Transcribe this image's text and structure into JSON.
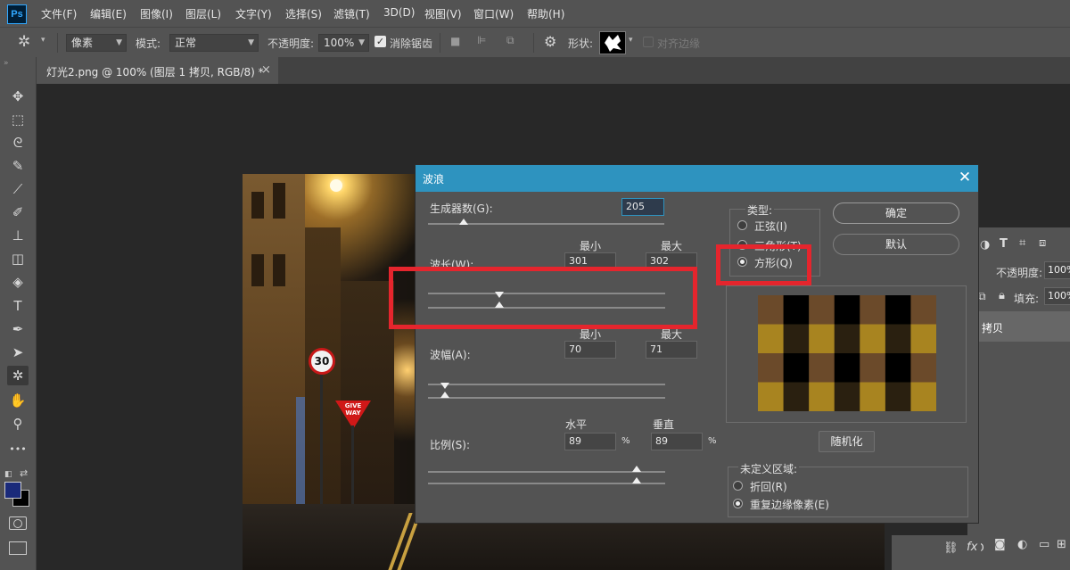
{
  "app": {
    "logo_text": "Ps",
    "accent": "#31a8ff"
  },
  "menu": [
    "文件(F)",
    "编辑(E)",
    "图像(I)",
    "图层(L)",
    "文字(Y)",
    "选择(S)",
    "滤镜(T)",
    "3D(D)",
    "视图(V)",
    "窗口(W)",
    "帮助(H)"
  ],
  "options": {
    "tool_icon": "puppet-warp-icon",
    "pixel_mode": "像素",
    "mode_label": "模式:",
    "mode_value": "正常",
    "opacity_label": "不透明度:",
    "opacity_value": "100%",
    "antialias_label": "消除锯齿",
    "antialias_checked": true,
    "shape_label": "形状:",
    "align_edges_label": "对齐边缘"
  },
  "document": {
    "tab_title": "灯光2.png @ 100% (图层 1 拷贝, RGB/8) *",
    "close": "×"
  },
  "toolbar": {
    "tools": [
      {
        "name": "move-tool-icon",
        "glyph": "✥"
      },
      {
        "name": "marquee-tool-icon",
        "glyph": "⬚"
      },
      {
        "name": "lasso-tool-icon",
        "glyph": "ᘓ"
      },
      {
        "name": "quick-select-tool-icon",
        "glyph": "✎"
      },
      {
        "name": "eyedropper-tool-icon",
        "glyph": "⟋"
      },
      {
        "name": "brush-tool-icon",
        "glyph": "✐"
      },
      {
        "name": "stamp-tool-icon",
        "glyph": "⊥"
      },
      {
        "name": "eraser-tool-icon",
        "glyph": "◫"
      },
      {
        "name": "bucket-tool-icon",
        "glyph": "◈"
      },
      {
        "name": "type-tool-icon",
        "glyph": "T"
      },
      {
        "name": "pen-tool-icon",
        "glyph": "✒"
      },
      {
        "name": "path-select-tool-icon",
        "glyph": "➤"
      },
      {
        "name": "shape-tool-icon",
        "glyph": "✲"
      },
      {
        "name": "hand-tool-icon",
        "glyph": "✋"
      },
      {
        "name": "zoom-tool-icon",
        "glyph": "⚲"
      },
      {
        "name": "more-tools-icon",
        "glyph": "•••"
      }
    ],
    "foreground_color": "#1a2a7a",
    "background_color": "#000000"
  },
  "photo": {
    "sign_speed": "30",
    "sign_give_way": "GIVE WAY"
  },
  "panel": {
    "opacity_label": "不透明度:",
    "opacity_value": "100%",
    "fill_label": "填充:",
    "fill_value": "100%",
    "layer_name": "拷贝",
    "bottom_icons": [
      "GO",
      "fx"
    ]
  },
  "dialog": {
    "title": "波浪",
    "close": "✕",
    "generators": {
      "label": "生成器数(G):",
      "value": "205",
      "slider": 0.15
    },
    "col_min": "最小",
    "col_max": "最大",
    "wavelength": {
      "label": "波长(W):",
      "min": "301",
      "max": "302",
      "min_slider": 0.3,
      "max_slider": 0.3
    },
    "amplitude": {
      "label": "波幅(A):",
      "min": "70",
      "max": "71",
      "min_slider": 0.07,
      "max_slider": 0.07
    },
    "col_h": "水平",
    "col_v": "垂直",
    "scale": {
      "label": "比例(S):",
      "h": "89",
      "v": "89",
      "unit": "%",
      "h_slider": 0.88,
      "v_slider": 0.88
    },
    "type": {
      "title": "类型:",
      "options": [
        "正弦(I)",
        "三角形(T)",
        "方形(Q)"
      ],
      "selected": 2
    },
    "ok": "确定",
    "reset": "默认",
    "randomize": "随机化",
    "undefined_area": {
      "title": "未定义区域:",
      "options": [
        "折回(R)",
        "重复边缘像素(E)"
      ],
      "selected": 1
    }
  },
  "highlight_color": "#e5252d"
}
